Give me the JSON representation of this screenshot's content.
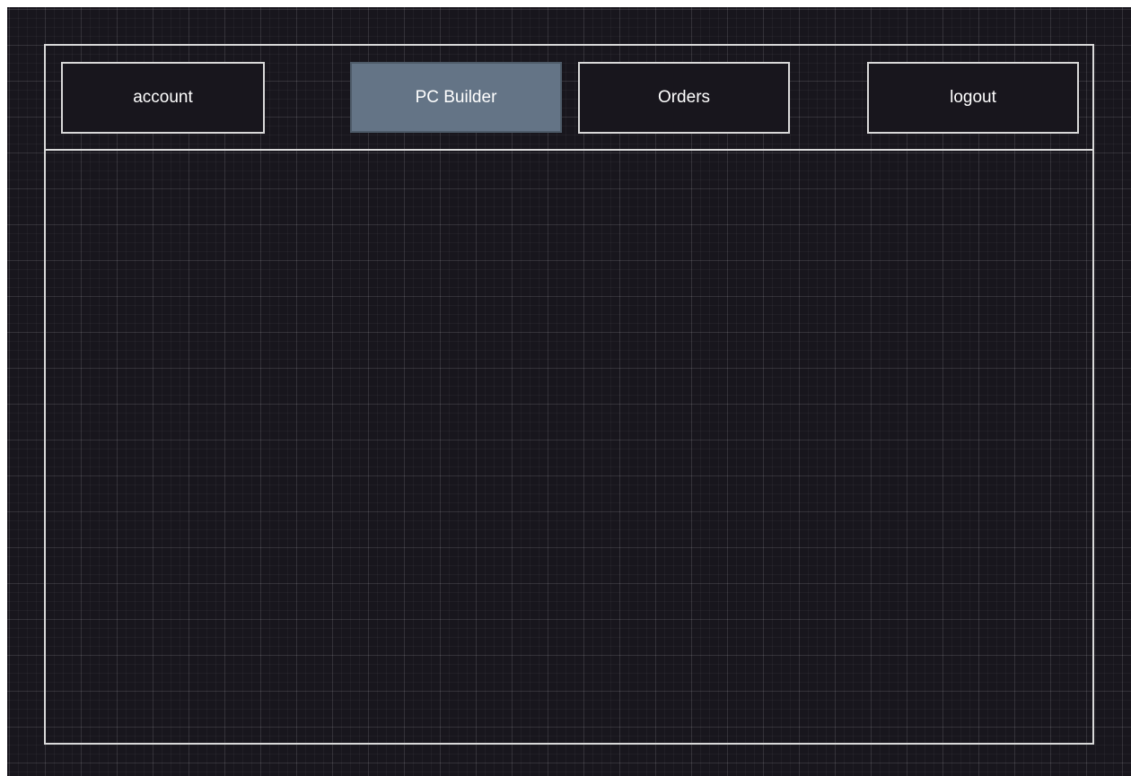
{
  "nav": {
    "account_label": "account",
    "pc_builder_label": "PC Builder",
    "orders_label": "Orders",
    "logout_label": "logout",
    "active_item": "PC Builder"
  },
  "colors": {
    "background": "#18161d",
    "border": "#d9d9d9",
    "active_button": "#647486",
    "text": "#ffffff"
  }
}
